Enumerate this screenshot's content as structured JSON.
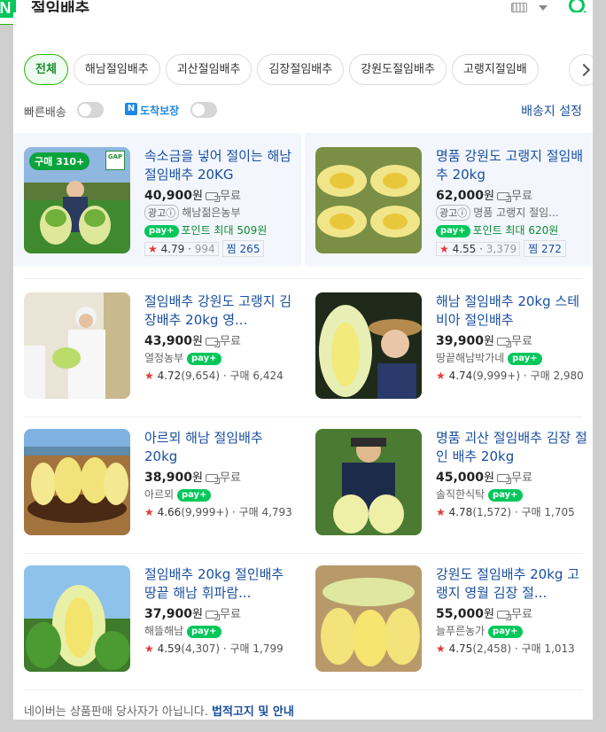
{
  "header": {
    "logo": "N",
    "query": "절임배추"
  },
  "chips": [
    "전체",
    "해남절임배추",
    "괴산절임배추",
    "김장절임배추",
    "강원도절임배추",
    "고랭지절임배"
  ],
  "filters": {
    "fast_delivery": "빠른배송",
    "arrive_badge": "N",
    "arrive_label": "도착보장",
    "destination": "배송지 설정"
  },
  "products": [
    {
      "title": "속소금을 넣어 절이는 해남 절임배추 20KG",
      "price": "40,900",
      "won": "원",
      "shipping": "무료",
      "ad": "광고ⓘ",
      "seller": "해남젊은농부",
      "point": "포인트 최대 509원",
      "rating": "4.79",
      "rating_count": "994",
      "zzim_label": "찜",
      "zzim": "265",
      "buy_badge": "구매 310+",
      "gap": "GAP"
    },
    {
      "title": "명품 강원도 고랭지 절임배추 20kg",
      "price": "62,000",
      "won": "원",
      "shipping": "무료",
      "ad": "광고ⓘ",
      "seller": "명품 고랭지 절임...",
      "point": "포인트 최대 620원",
      "rating": "4.55",
      "rating_count": "3,379",
      "zzim_label": "찜",
      "zzim": "272"
    },
    {
      "title": "절임배추 강원도 고랭지 김장배추 20kg 영...",
      "price": "43,900",
      "won": "원",
      "shipping": "무료",
      "seller": "열정농부",
      "rating": "4.72",
      "rating_count": "(9,654)",
      "purchase": "구매 6,424"
    },
    {
      "title": "해남 절임배추 20kg 스테비아 절인배추",
      "price": "39,900",
      "won": "원",
      "shipping": "무료",
      "seller": "땅끝해남박가네",
      "rating": "4.74",
      "rating_count": "(9,999+)",
      "purchase": "구매 2,980"
    },
    {
      "title": "아르뫼 해남 절임배추 20kg",
      "price": "38,900",
      "won": "원",
      "shipping": "무료",
      "seller": "아르뫼",
      "rating": "4.66",
      "rating_count": "(9,999+)",
      "purchase": "구매 4,793"
    },
    {
      "title": "명품 괴산 절임배추 김장 절인 배추 20kg",
      "price": "45,000",
      "won": "원",
      "shipping": "무료",
      "seller": "솔직한식탁",
      "rating": "4.78",
      "rating_count": "(1,572)",
      "purchase": "구매 1,705"
    },
    {
      "title": "절임배추 20kg 절인배추 땅끝 해남 휘파람...",
      "price": "37,900",
      "won": "원",
      "shipping": "무료",
      "seller": "해뜰해남",
      "rating": "4.59",
      "rating_count": "(4,307)",
      "purchase": "구매 1,799"
    },
    {
      "title": "강원도 절임배추 20kg 고랭지 영월 김장 절...",
      "price": "55,000",
      "won": "원",
      "shipping": "무료",
      "seller": "늘푸른농가",
      "rating": "4.75",
      "rating_count": "(2,458)",
      "purchase": "구매 1,013"
    }
  ],
  "npay_label": "pay+",
  "footer": {
    "text": "네이버는 상품판매 당사자가 아닙니다.",
    "link": "법적고지 및 안내"
  },
  "colors": {
    "brand": "#03c75a",
    "link": "#1a4fa0",
    "star": "#e53935"
  }
}
